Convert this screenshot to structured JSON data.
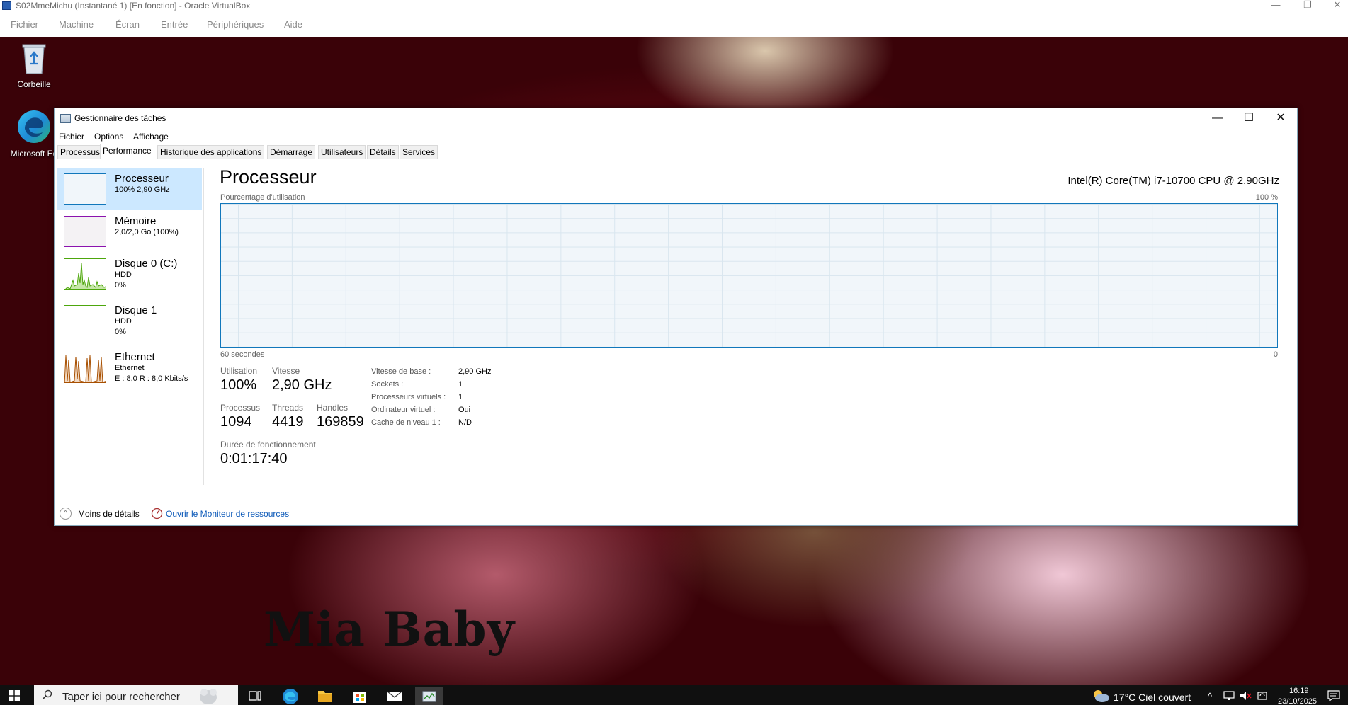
{
  "vbox": {
    "title": "S02MmeMichu (Instantané 1) [En fonction] - Oracle VirtualBox",
    "menu": [
      "Fichier",
      "Machine",
      "Écran",
      "Entrée",
      "Périphériques",
      "Aide"
    ],
    "window_controls": {
      "minimize": "—",
      "restore": "❐",
      "close": "✕"
    }
  },
  "desktop": {
    "icons": [
      {
        "label": "Corbeille",
        "icon": "recycle-bin-icon"
      },
      {
        "label": "Microsoft Ed",
        "icon": "edge-icon"
      }
    ],
    "watermark": "Mia Baby"
  },
  "taskmgr": {
    "title": "Gestionnaire des tâches",
    "controls": {
      "minimize": "—",
      "maximize": "☐",
      "close": "✕"
    },
    "menu": [
      "Fichier",
      "Options",
      "Affichage"
    ],
    "tabs": [
      "Processus",
      "Performance",
      "Historique des applications",
      "Démarrage",
      "Utilisateurs",
      "Détails",
      "Services"
    ],
    "active_tab": "Performance",
    "sidebar": [
      {
        "name": "Processeur",
        "line1": "100% 2,90 GHz",
        "line2": "",
        "color": "#1177bb",
        "selected": true
      },
      {
        "name": "Mémoire",
        "line1": "2,0/2,0 Go (100%)",
        "line2": "",
        "color": "#8b12ae",
        "selected": false
      },
      {
        "name": "Disque 0 (C:)",
        "line1": "HDD",
        "line2": "0%",
        "color": "#4da60c",
        "selected": false
      },
      {
        "name": "Disque 1",
        "line1": "HDD",
        "line2": "0%",
        "color": "#4da60c",
        "selected": false
      },
      {
        "name": "Ethernet",
        "line1": "Ethernet",
        "line2": "E : 8,0 R : 8,0 Kbits/s",
        "color": "#a74f01",
        "selected": false
      }
    ],
    "main": {
      "title": "Processeur",
      "model": "Intel(R) Core(TM) i7-10700 CPU @ 2.90GHz",
      "graph_label": "Pourcentage d'utilisation",
      "graph_max": "100 %",
      "graph_time": "60 secondes",
      "graph_min": "0",
      "stats": {
        "utilisation_label": "Utilisation",
        "utilisation": "100%",
        "vitesse_label": "Vitesse",
        "vitesse": "2,90 GHz",
        "processus_label": "Processus",
        "processus": "1094",
        "threads_label": "Threads",
        "threads": "4419",
        "handles_label": "Handles",
        "handles": "169859",
        "uptime_label": "Durée de fonctionnement",
        "uptime": "0:01:17:40"
      },
      "specs": [
        {
          "label": "Vitesse de base :",
          "value": "2,90 GHz"
        },
        {
          "label": "Sockets :",
          "value": "1"
        },
        {
          "label": "Processeurs virtuels :",
          "value": "1"
        },
        {
          "label": "Ordinateur virtuel :",
          "value": "Oui"
        },
        {
          "label": "Cache de niveau 1 :",
          "value": "N/D"
        }
      ]
    },
    "footer": {
      "less_details": "Moins de détails",
      "resource_monitor": "Ouvrir le Moniteur de ressources"
    }
  },
  "taskbar": {
    "search_placeholder": "Taper ici pour rechercher",
    "apps": [
      "task-view-icon",
      "edge-icon",
      "file-explorer-icon",
      "store-icon",
      "mail-icon",
      "task-manager-icon"
    ],
    "weather": "17°C  Ciel couvert",
    "time": "16:19",
    "date": "23/10/2025"
  }
}
